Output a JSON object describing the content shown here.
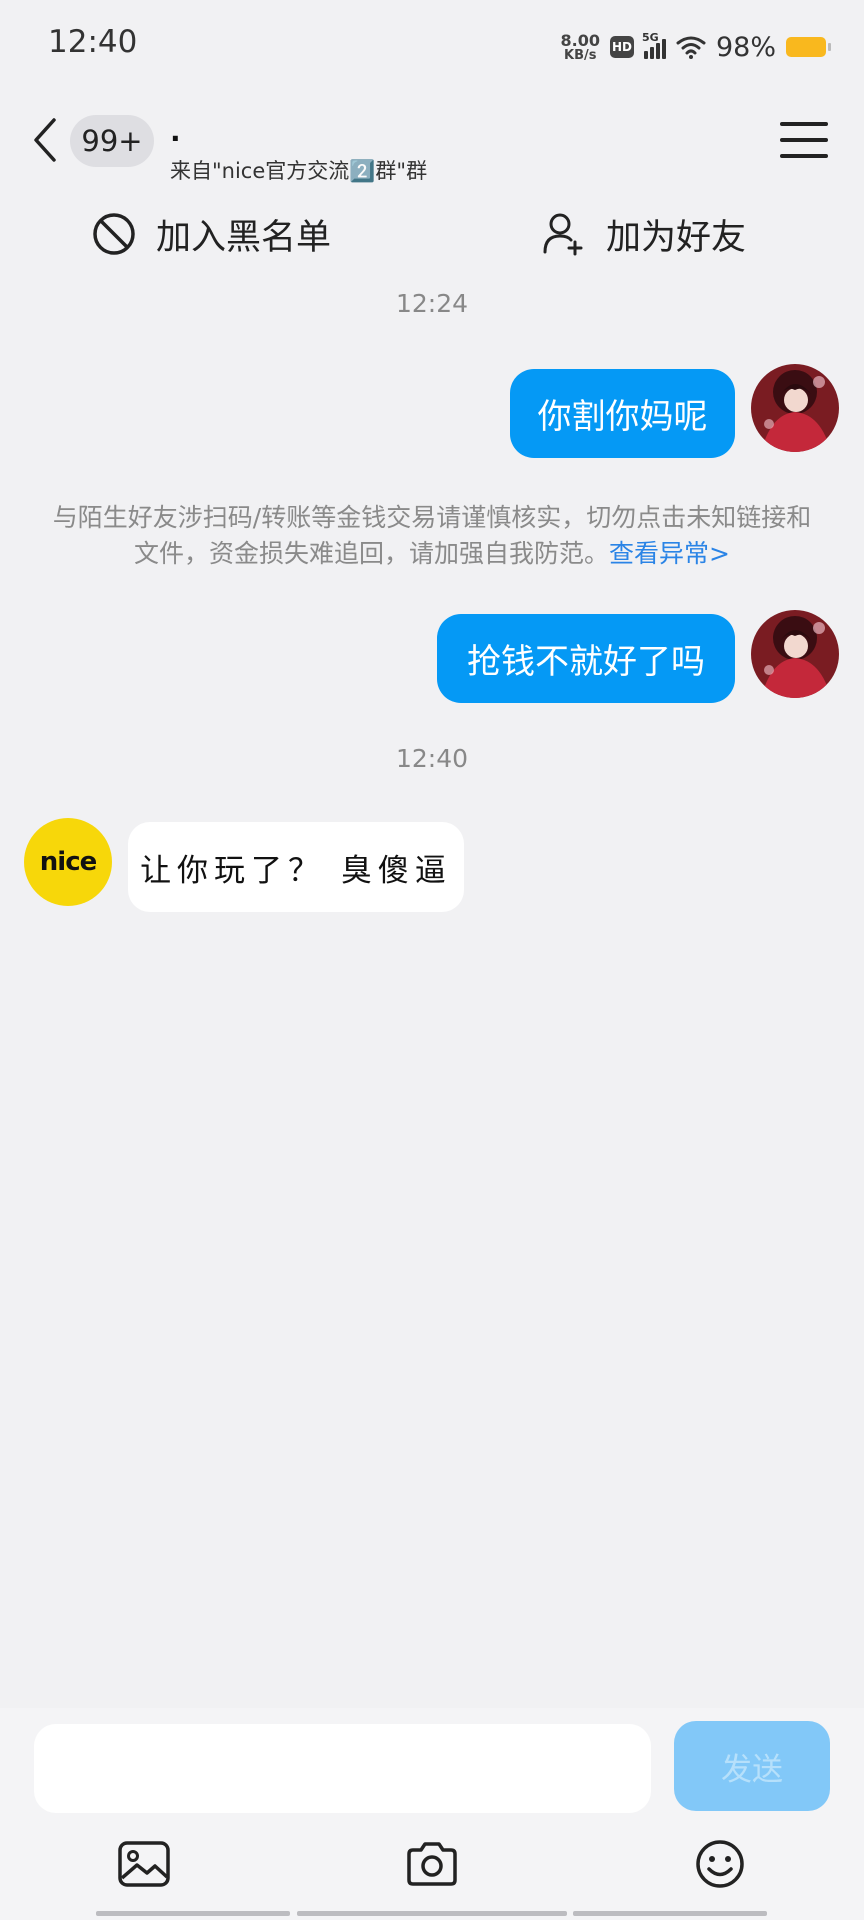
{
  "status_bar": {
    "time": "12:40",
    "net_speed_value": "8.00",
    "net_speed_unit": "KB/s",
    "hd": "HD",
    "network": "5G",
    "battery_percent": "98%",
    "battery_color": "#f9b81e"
  },
  "header": {
    "unread_count": "99+",
    "title": "·",
    "subtitle": "来自\"nice官方交流2️⃣群\"群"
  },
  "actions": {
    "blacklist_label": "加入黑名单",
    "add_friend_label": "加为好友"
  },
  "messages": {
    "timestamp_1": "12:24",
    "msg_1": "你割你妈呢",
    "notice_text": "与陌生好友涉扫码/转账等金钱交易请谨慎核实，切勿点击未知链接和文件，资金损失难追回，请加强自我防范。",
    "notice_link": "查看异常>",
    "msg_2": "抢钱不就好了吗",
    "timestamp_2": "12:40",
    "peer_avatar_text": "nice",
    "msg_3": "让你玩了？ 臭傻逼"
  },
  "input": {
    "placeholder": "",
    "send_label": "发送"
  },
  "colors": {
    "outgoing_bubble": "#0599f5",
    "background": "#f1f1f3",
    "link": "#2a84e6",
    "send_disabled": "#82c8f8"
  },
  "icons": [
    "back-icon",
    "menu-icon",
    "block-icon",
    "add-user-icon",
    "image-icon",
    "camera-icon",
    "emoji-icon"
  ]
}
